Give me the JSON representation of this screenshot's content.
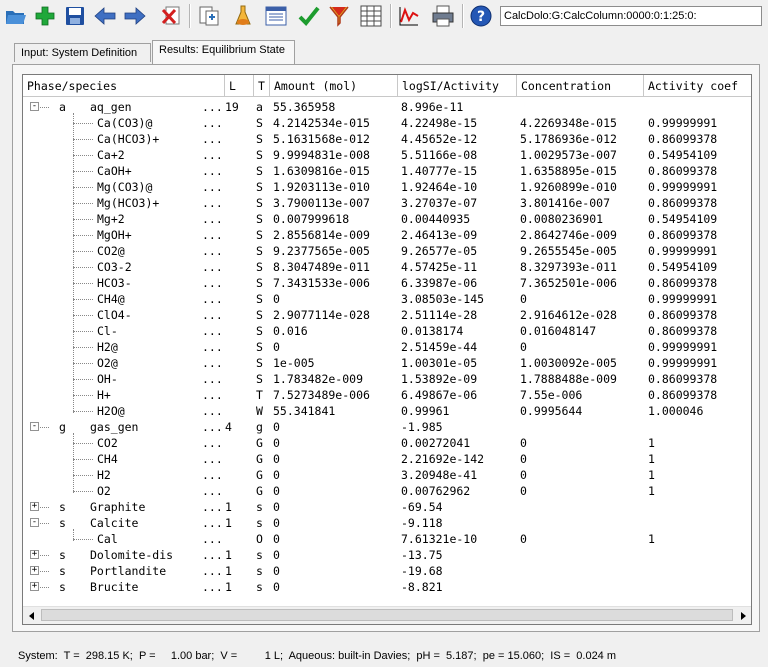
{
  "toolbar": {
    "path": "CalcDolo:G:CalcColumn:0000:0:1:25:0:",
    "buttons": [
      "open-icon",
      "add-icon",
      "save-icon",
      "back-arrow-icon",
      "forward-arrow-icon",
      "delete-icon",
      "export-icon",
      "flask-icon",
      "list-icon",
      "check-icon",
      "funnel-icon",
      "table-icon",
      "chart-icon",
      "print-icon",
      "help-icon"
    ]
  },
  "tabs": [
    {
      "label": "Input: System Definition",
      "active": false
    },
    {
      "label": "Results: Equilibrium State",
      "active": true
    }
  ],
  "columns": [
    "Phase/species",
    "L",
    "T",
    "Amount (mol)",
    "logSI/Activity",
    "Concentration",
    "Activity coef"
  ],
  "rows": [
    {
      "level": 0,
      "exp": "-",
      "code": "a",
      "name": "aq_gen",
      "dots": "...",
      "l": "19",
      "t": "a",
      "amount": "55.365958",
      "logsi": "8.996e-11",
      "conc": "",
      "act": ""
    },
    {
      "level": 1,
      "name": "Ca(CO3)@",
      "dots": "...",
      "l": "",
      "t": "S",
      "amount": "4.2142534e-015",
      "logsi": "4.22498e-15",
      "conc": "4.2269348e-015",
      "act": "0.99999991"
    },
    {
      "level": 1,
      "name": "Ca(HCO3)+",
      "dots": "...",
      "l": "",
      "t": "S",
      "amount": "5.1631568e-012",
      "logsi": "4.45652e-12",
      "conc": "5.1786936e-012",
      "act": "0.86099378"
    },
    {
      "level": 1,
      "name": "Ca+2",
      "dots": "...",
      "l": "",
      "t": "S",
      "amount": "9.9994831e-008",
      "logsi": "5.51166e-08",
      "conc": "1.0029573e-007",
      "act": "0.54954109"
    },
    {
      "level": 1,
      "name": "CaOH+",
      "dots": "...",
      "l": "",
      "t": "S",
      "amount": "1.6309816e-015",
      "logsi": "1.40777e-15",
      "conc": "1.6358895e-015",
      "act": "0.86099378"
    },
    {
      "level": 1,
      "name": "Mg(CO3)@",
      "dots": "...",
      "l": "",
      "t": "S",
      "amount": "1.9203113e-010",
      "logsi": "1.92464e-10",
      "conc": "1.9260899e-010",
      "act": "0.99999991"
    },
    {
      "level": 1,
      "name": "Mg(HCO3)+",
      "dots": "...",
      "l": "",
      "t": "S",
      "amount": "3.7900113e-007",
      "logsi": "3.27037e-07",
      "conc": "3.801416e-007",
      "act": "0.86099378"
    },
    {
      "level": 1,
      "name": "Mg+2",
      "dots": "...",
      "l": "",
      "t": "S",
      "amount": "0.007999618",
      "logsi": "0.00440935",
      "conc": "0.0080236901",
      "act": "0.54954109"
    },
    {
      "level": 1,
      "name": "MgOH+",
      "dots": "...",
      "l": "",
      "t": "S",
      "amount": "2.8556814e-009",
      "logsi": "2.46413e-09",
      "conc": "2.8642746e-009",
      "act": "0.86099378"
    },
    {
      "level": 1,
      "name": "CO2@",
      "dots": "...",
      "l": "",
      "t": "S",
      "amount": "9.2377565e-005",
      "logsi": "9.26577e-05",
      "conc": "9.2655545e-005",
      "act": "0.99999991"
    },
    {
      "level": 1,
      "name": "CO3-2",
      "dots": "...",
      "l": "",
      "t": "S",
      "amount": "8.3047489e-011",
      "logsi": "4.57425e-11",
      "conc": "8.3297393e-011",
      "act": "0.54954109"
    },
    {
      "level": 1,
      "name": "HCO3-",
      "dots": "...",
      "l": "",
      "t": "S",
      "amount": "7.3431533e-006",
      "logsi": "6.33987e-06",
      "conc": "7.3652501e-006",
      "act": "0.86099378"
    },
    {
      "level": 1,
      "name": "CH4@",
      "dots": "...",
      "l": "",
      "t": "S",
      "amount": "0",
      "logsi": "3.08503e-145",
      "conc": "0",
      "act": "0.99999991"
    },
    {
      "level": 1,
      "name": "ClO4-",
      "dots": "...",
      "l": "",
      "t": "S",
      "amount": "2.9077114e-028",
      "logsi": "2.51114e-28",
      "conc": "2.9164612e-028",
      "act": "0.86099378"
    },
    {
      "level": 1,
      "name": "Cl-",
      "dots": "...",
      "l": "",
      "t": "S",
      "amount": "0.016",
      "logsi": "0.0138174",
      "conc": "0.016048147",
      "act": "0.86099378"
    },
    {
      "level": 1,
      "name": "H2@",
      "dots": "...",
      "l": "",
      "t": "S",
      "amount": "0",
      "logsi": "2.51459e-44",
      "conc": "0",
      "act": "0.99999991"
    },
    {
      "level": 1,
      "name": "O2@",
      "dots": "...",
      "l": "",
      "t": "S",
      "amount": "1e-005",
      "logsi": "1.00301e-05",
      "conc": "1.0030092e-005",
      "act": "0.99999991"
    },
    {
      "level": 1,
      "name": "OH-",
      "dots": "...",
      "l": "",
      "t": "S",
      "amount": "1.783482e-009",
      "logsi": "1.53892e-09",
      "conc": "1.7888488e-009",
      "act": "0.86099378"
    },
    {
      "level": 1,
      "name": "H+",
      "dots": "...",
      "l": "",
      "t": "T",
      "amount": "7.5273489e-006",
      "logsi": "6.49867e-06",
      "conc": "7.55e-006",
      "act": "0.86099378"
    },
    {
      "level": 1,
      "name": "H2O@",
      "dots": "...",
      "l": "",
      "t": "W",
      "amount": "55.341841",
      "logsi": "0.99961",
      "conc": "0.9995644",
      "act": "1.000046",
      "last": true
    },
    {
      "level": 0,
      "exp": "-",
      "code": "g",
      "name": "gas_gen",
      "dots": "...",
      "l": "4",
      "t": "g",
      "amount": "0",
      "logsi": "-1.985",
      "conc": "",
      "act": ""
    },
    {
      "level": 1,
      "name": "CO2",
      "dots": "...",
      "l": "",
      "t": "G",
      "amount": "0",
      "logsi": "0.00272041",
      "conc": "0",
      "act": "1"
    },
    {
      "level": 1,
      "name": "CH4",
      "dots": "...",
      "l": "",
      "t": "G",
      "amount": "0",
      "logsi": "2.21692e-142",
      "conc": "0",
      "act": "1"
    },
    {
      "level": 1,
      "name": "H2",
      "dots": "...",
      "l": "",
      "t": "G",
      "amount": "0",
      "logsi": "3.20948e-41",
      "conc": "0",
      "act": "1"
    },
    {
      "level": 1,
      "name": "O2",
      "dots": "...",
      "l": "",
      "t": "G",
      "amount": "0",
      "logsi": "0.00762962",
      "conc": "0",
      "act": "1",
      "last": true
    },
    {
      "level": 0,
      "exp": "+",
      "code": "s",
      "name": "Graphite",
      "dots": "...",
      "l": "1",
      "t": "s",
      "amount": "0",
      "logsi": "-69.54",
      "conc": "",
      "act": ""
    },
    {
      "level": 0,
      "exp": "-",
      "code": "s",
      "name": "Calcite",
      "dots": "...",
      "l": "1",
      "t": "s",
      "amount": "0",
      "logsi": "-9.118",
      "conc": "",
      "act": ""
    },
    {
      "level": 1,
      "name": "Cal",
      "dots": "...",
      "l": "",
      "t": "O",
      "amount": "0",
      "logsi": "7.61321e-10",
      "conc": "0",
      "act": "1",
      "last": true
    },
    {
      "level": 0,
      "exp": "+",
      "code": "s",
      "name": "Dolomite-dis",
      "dots": "...",
      "l": "1",
      "t": "s",
      "amount": "0",
      "logsi": "-13.75",
      "conc": "",
      "act": ""
    },
    {
      "level": 0,
      "exp": "+",
      "code": "s",
      "name": "Portlandite",
      "dots": "...",
      "l": "1",
      "t": "s",
      "amount": "0",
      "logsi": "-19.68",
      "conc": "",
      "act": ""
    },
    {
      "level": 0,
      "exp": "+",
      "code": "s",
      "name": "Brucite",
      "dots": "...",
      "l": "1",
      "t": "s",
      "amount": "0",
      "logsi": "-8.821",
      "conc": "",
      "act": ""
    }
  ],
  "status": "System:  T =  298.15 K;  P =     1.00 bar;  V =         1 L;  Aqueous: built-in Davies;  pH =  5.187;  pe = 15.060;  IS =  0.024 m"
}
